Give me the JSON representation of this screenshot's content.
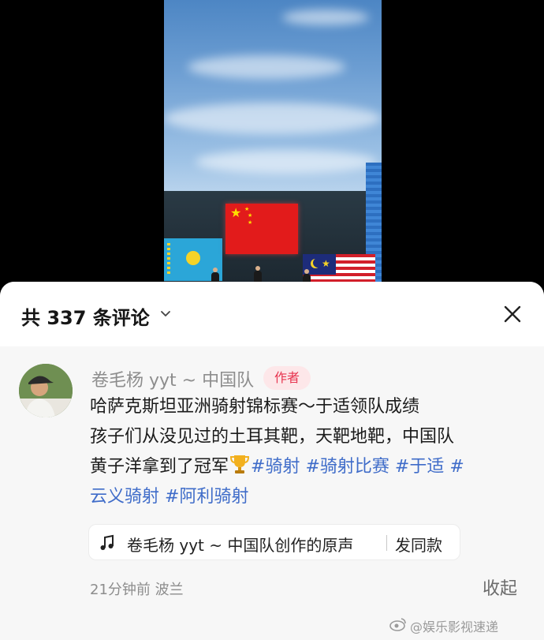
{
  "comments_panel": {
    "title": "共 337 条评论",
    "close_icon": "close-icon",
    "sort_icon": "chevron-down-icon"
  },
  "comment": {
    "username": "卷毛杨 yyt ~ 中国队",
    "badge": "作者",
    "lines": [
      "哈萨克斯坦亚洲骑射锦标赛～于适领队成绩",
      "孩子们从没见过的土耳其靶，天靶地靶，中国队",
      "黄子洋拿到了冠军"
    ],
    "tags": [
      "#骑射",
      "#骑射比赛",
      "#于适",
      "#",
      "云义骑射",
      "#阿利骑射"
    ],
    "sound": {
      "text": "卷毛杨 yyt ~ 中国队创作的原声",
      "action": "发同款"
    },
    "meta": "21分钟前 波兰",
    "collapse": "收起"
  },
  "watermark": "@娱乐影视速递",
  "colors": {
    "tag": "#3f6cc9",
    "badge_text": "#e7344f",
    "badge_bg": "#fde7e9",
    "sheet_bg": "#f7f7f7"
  }
}
